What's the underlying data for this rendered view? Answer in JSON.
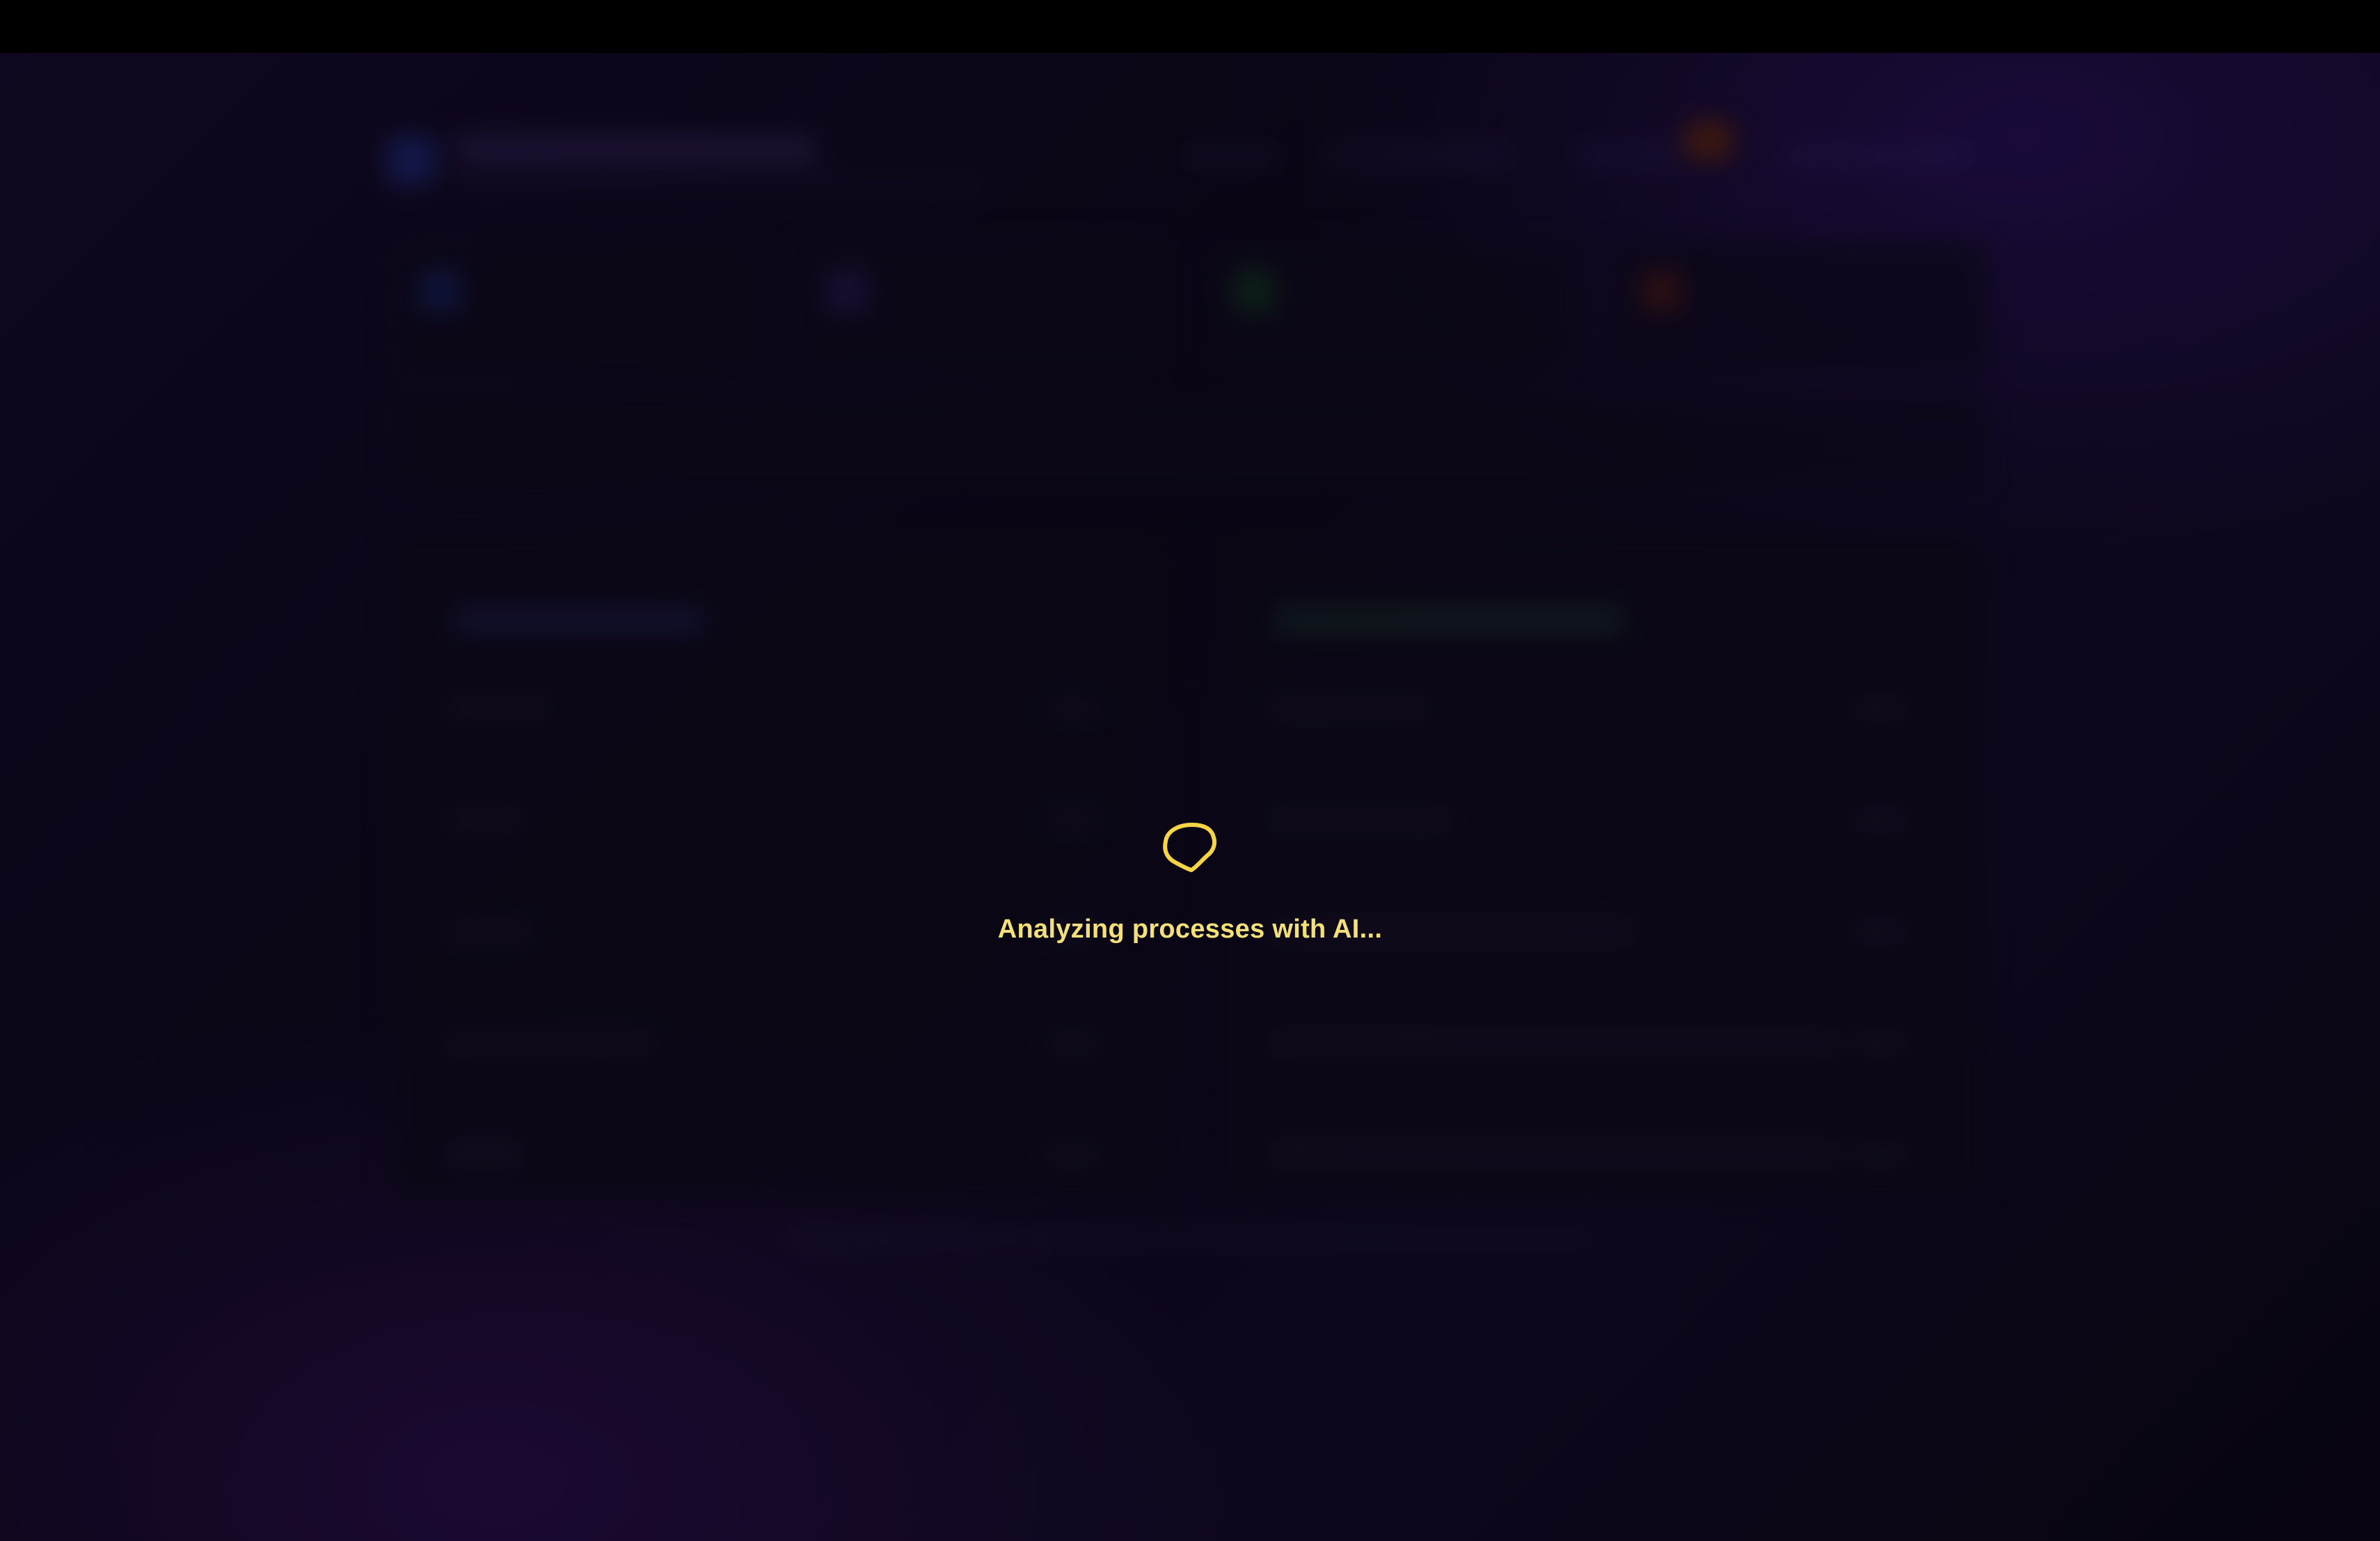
{
  "overlay": {
    "spinner_icon": "loading-spinner-icon",
    "message": "Analyzing processes with AI..."
  },
  "colors": {
    "accent": "#f5d547",
    "message_text": "#f4e07a",
    "top_bar": "#000000",
    "background_dark": "#0c0819",
    "background_purple": "#2a1260"
  }
}
